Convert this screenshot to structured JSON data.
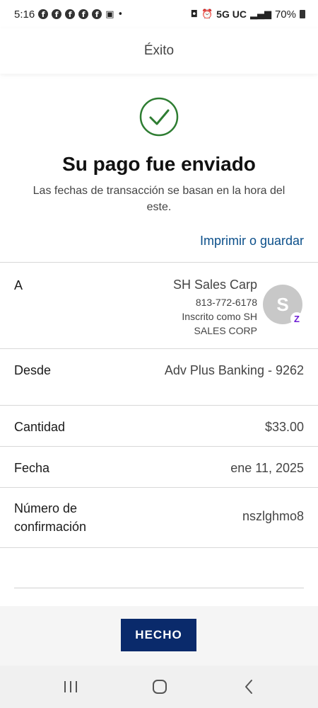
{
  "status_bar": {
    "time": "5:16",
    "network": "5G UC",
    "battery": "70%"
  },
  "header": {
    "title": "Éxito"
  },
  "confirmation": {
    "title": "Su pago fue enviado",
    "subtitle": "Las fechas de transacción se basan en la hora del este.",
    "print_link": "Imprimir o guardar"
  },
  "details": {
    "to": {
      "label": "A",
      "name": "SH Sales Carp",
      "phone": "813-772-6178",
      "enrolled_line1": "Inscrito como SH",
      "enrolled_line2": "SALES CORP",
      "avatar_initial": "S",
      "badge": "Z"
    },
    "from": {
      "label": "Desde",
      "value": "Adv Plus Banking - 9262"
    },
    "amount": {
      "label": "Cantidad",
      "value": "$33.00"
    },
    "date": {
      "label": "Fecha",
      "value": "ene 11, 2025"
    },
    "confirmation_number": {
      "label_line1": "Número de",
      "label_line2": "confirmación",
      "value": "nszlghmo8"
    }
  },
  "footer": {
    "done_label": "HECHO"
  },
  "colors": {
    "success_green": "#2e7d32",
    "link_blue": "#0b4f8a",
    "button_navy": "#0a2a6b",
    "zelle_purple": "#6d1ed4"
  }
}
